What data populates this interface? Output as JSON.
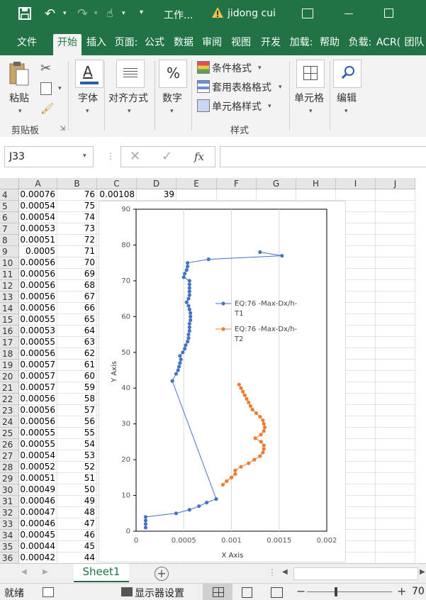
{
  "titlebar": {
    "doc_title": "工作...",
    "user_name": "jidong cui"
  },
  "tabs": [
    "文件",
    "开始",
    "插入",
    "页面:",
    "公式",
    "数据",
    "审阅",
    "视图",
    "开发",
    "加载:",
    "帮助",
    "负载:",
    "ACR(",
    "团队"
  ],
  "active_tab": "开始",
  "ribbon": {
    "paste_label": "粘贴",
    "clipboard_group": "剪贴板",
    "font_label": "字体",
    "align_label": "对齐方式",
    "number_label": "数字",
    "number_icon": "%",
    "conditional_format": "条件格式",
    "table_format": "套用表格格式",
    "cell_style": "单元格样式",
    "styles_group": "样式",
    "cells_label": "单元格",
    "edit_label": "编辑"
  },
  "formula_bar": {
    "name_box": "J33",
    "fx": "fx",
    "formula": ""
  },
  "columns": [
    "A",
    "B",
    "C",
    "D",
    "E",
    "F",
    "G",
    "H",
    "I",
    "J"
  ],
  "rows": [
    {
      "n": "4",
      "a": "0.00076",
      "b": "76",
      "c": "0.00108",
      "d": "39"
    },
    {
      "n": "5",
      "a": "0.00054",
      "b": "75"
    },
    {
      "n": "6",
      "a": "0.00054",
      "b": "74"
    },
    {
      "n": "7",
      "a": "0.00053",
      "b": "73"
    },
    {
      "n": "8",
      "a": "0.00051",
      "b": "72"
    },
    {
      "n": "9",
      "a": "0.0005",
      "b": "71"
    },
    {
      "n": "10",
      "a": "0.00056",
      "b": "70"
    },
    {
      "n": "11",
      "a": "0.00056",
      "b": "69"
    },
    {
      "n": "12",
      "a": "0.00056",
      "b": "68"
    },
    {
      "n": "13",
      "a": "0.00056",
      "b": "67"
    },
    {
      "n": "14",
      "a": "0.00056",
      "b": "66"
    },
    {
      "n": "15",
      "a": "0.00055",
      "b": "65"
    },
    {
      "n": "16",
      "a": "0.00053",
      "b": "64"
    },
    {
      "n": "17",
      "a": "0.00055",
      "b": "63"
    },
    {
      "n": "18",
      "a": "0.00056",
      "b": "62"
    },
    {
      "n": "19",
      "a": "0.00057",
      "b": "61"
    },
    {
      "n": "20",
      "a": "0.00057",
      "b": "60"
    },
    {
      "n": "21",
      "a": "0.00057",
      "b": "59"
    },
    {
      "n": "22",
      "a": "0.00056",
      "b": "58"
    },
    {
      "n": "23",
      "a": "0.00056",
      "b": "57"
    },
    {
      "n": "24",
      "a": "0.00056",
      "b": "56"
    },
    {
      "n": "25",
      "a": "0.00055",
      "b": "55"
    },
    {
      "n": "26",
      "a": "0.00055",
      "b": "54"
    },
    {
      "n": "27",
      "a": "0.00054",
      "b": "53"
    },
    {
      "n": "28",
      "a": "0.00052",
      "b": "52"
    },
    {
      "n": "29",
      "a": "0.00051",
      "b": "51"
    },
    {
      "n": "30",
      "a": "0.00049",
      "b": "50"
    },
    {
      "n": "31",
      "a": "0.00046",
      "b": "49"
    },
    {
      "n": "32",
      "a": "0.00047",
      "b": "48"
    },
    {
      "n": "33",
      "a": "0.00046",
      "b": "47"
    },
    {
      "n": "34",
      "a": "0.00045",
      "b": "46"
    },
    {
      "n": "35",
      "a": "0.00044",
      "b": "45"
    },
    {
      "n": "36",
      "a": "0.00042",
      "b": "44"
    }
  ],
  "chart_data": {
    "type": "scatter",
    "xlabel": "X Axis",
    "ylabel": "Y Axis",
    "xlim": [
      0,
      0.002
    ],
    "ylim": [
      0,
      90
    ],
    "xticks": [
      "0",
      "0.0005",
      "0.001",
      "0.0015",
      "0.002"
    ],
    "yticks": [
      "0",
      "10",
      "20",
      "30",
      "40",
      "50",
      "60",
      "70",
      "80",
      "90"
    ],
    "legend_position": "right",
    "series": [
      {
        "name": "EQ:76 -Max-Dx/h-T1",
        "color": "#4472c4",
        "x": [
          0.0013,
          0.00153,
          0.00076,
          0.00054,
          0.00054,
          0.00053,
          0.00051,
          0.0005,
          0.00056,
          0.00056,
          0.00056,
          0.00056,
          0.00056,
          0.00055,
          0.00053,
          0.00055,
          0.00056,
          0.00057,
          0.00057,
          0.00057,
          0.00056,
          0.00056,
          0.00056,
          0.00055,
          0.00055,
          0.00054,
          0.00052,
          0.00051,
          0.00049,
          0.00046,
          0.00047,
          0.00046,
          0.00045,
          0.00044,
          0.00042,
          0.00038,
          0.00084,
          0.00074,
          0.00066,
          0.00056,
          0.00042,
          0.0001,
          0.0001,
          0.0001,
          0.0001
        ],
        "y": [
          78,
          77,
          76,
          75,
          74,
          73,
          72,
          71,
          70,
          69,
          68,
          67,
          66,
          65,
          64,
          63,
          62,
          61,
          60,
          59,
          58,
          57,
          56,
          55,
          54,
          53,
          52,
          51,
          50,
          49,
          48,
          47,
          46,
          45,
          44,
          42,
          9,
          8,
          7,
          6,
          5,
          4,
          3,
          2,
          1
        ]
      },
      {
        "name": "EQ:76 -Max-Dx/h-T2",
        "color": "#ed7d31",
        "x": [
          0.00108,
          0.0011,
          0.00112,
          0.00114,
          0.00116,
          0.00118,
          0.0012,
          0.00122,
          0.00126,
          0.0013,
          0.00133,
          0.00134,
          0.00135,
          0.00134,
          0.00131,
          0.00125,
          0.00131,
          0.00134,
          0.00134,
          0.00133,
          0.0013,
          0.00124,
          0.00118,
          0.0011,
          0.00104,
          0.00104,
          0.001,
          0.00095,
          0.00091
        ],
        "y": [
          41,
          40,
          39,
          38,
          37,
          36,
          35,
          34,
          33,
          32,
          31,
          30,
          29,
          28,
          27,
          26,
          25,
          24,
          23,
          22,
          21,
          20,
          19,
          18,
          17,
          16,
          15,
          14,
          13
        ]
      }
    ]
  },
  "sheet_tab": "Sheet1",
  "status": {
    "ready": "就绪",
    "display_settings": "显示器设置",
    "zoom": "70"
  }
}
